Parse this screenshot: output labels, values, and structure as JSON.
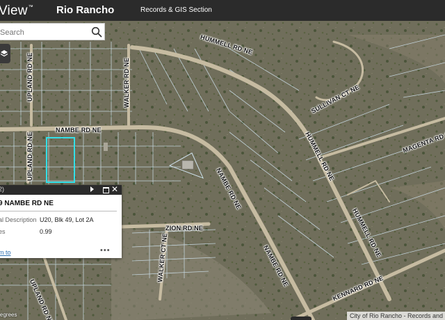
{
  "header": {
    "brand": "View",
    "brand_mark": "™",
    "city": "Rio Rancho",
    "section": "Records & GIS Section"
  },
  "search": {
    "placeholder": "Search",
    "value": ""
  },
  "popup": {
    "count": "2)",
    "title": "9 NAMBE RD NE",
    "fields": [
      {
        "label": "al Description",
        "value": "U20, Blk 49, Lot 2A"
      },
      {
        "label": "es",
        "value": "0.99"
      }
    ],
    "zoom_label": "m to",
    "more_label": "•••"
  },
  "roads": [
    "HUMMELL RD NE",
    "UPLAND RD NE",
    "WALKER RD NE",
    "SULLIVAN CT NE",
    "NAMBE RD NE",
    "HUMMELL RD NE",
    "MAGENTA RD NE",
    "UPLAND RD NE",
    "NAMBE RD NE",
    "ZION RD NE",
    "WALKER CT NE",
    "NAMBE RD NE",
    "HUMMELL RD NE",
    "UPLAND RD NE",
    "KENNARD RD NE"
  ],
  "footer": {
    "attribution": "City of Rio Rancho - Records and",
    "coords": "egrees"
  },
  "colors": {
    "header": "#2b2b2b",
    "terrain": "#6f6d5a",
    "parcel_line": "#cfe3ee",
    "selected_parcel": "#33e0e8",
    "road": "#cbbfa6"
  }
}
